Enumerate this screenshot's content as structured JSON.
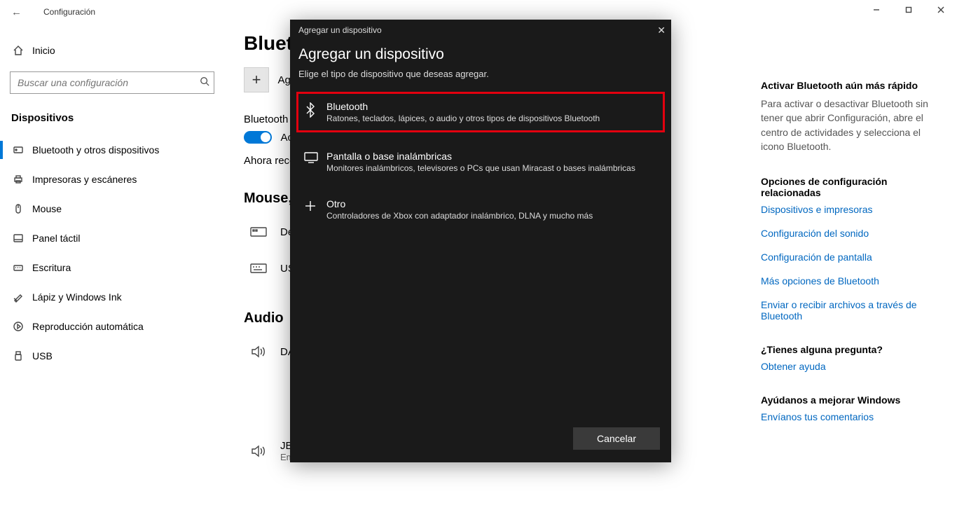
{
  "window": {
    "title": "Configuración",
    "back_icon": "back-arrow"
  },
  "sidebar": {
    "home_label": "Inicio",
    "search_placeholder": "Buscar una configuración",
    "heading": "Dispositivos",
    "items": [
      {
        "label": "Bluetooth y otros dispositivos",
        "icon": "bluetooth-icon",
        "active": true
      },
      {
        "label": "Impresoras y escáneres",
        "icon": "printer-icon"
      },
      {
        "label": "Mouse",
        "icon": "mouse-icon"
      },
      {
        "label": "Panel táctil",
        "icon": "touchpad-icon"
      },
      {
        "label": "Escritura",
        "icon": "keyboard-icon"
      },
      {
        "label": "Lápiz y Windows Ink",
        "icon": "pen-icon"
      },
      {
        "label": "Reproducción automática",
        "icon": "autoplay-icon"
      },
      {
        "label": "USB",
        "icon": "usb-icon"
      }
    ]
  },
  "main": {
    "page_title": "Bluetooth y otros dispositivos",
    "add_label": "Agregar Bluetooth u otro dispositivo",
    "bt_heading": "Bluetooth",
    "toggle_label": "Activado",
    "discover_text": "Ahora reconocible como",
    "mouse_heading": "Mouse, teclado y lápiz",
    "dev_dell": "De",
    "dev_usb": "US",
    "audio_heading": "Audio",
    "dev_da": "DA",
    "jbl_name": "JBL Xtreme",
    "jbl_status": "Emparejado"
  },
  "rpanel": {
    "tip_h": "Activar Bluetooth aún más rápido",
    "tip_txt": "Para activar o desactivar Bluetooth sin tener que abrir Configuración, abre el centro de actividades y selecciona el icono Bluetooth.",
    "related_h": "Opciones de configuración relacionadas",
    "links": [
      "Dispositivos e impresoras",
      "Configuración del sonido",
      "Configuración de pantalla",
      "Más opciones de Bluetooth",
      "Enviar o recibir archivos a través de Bluetooth"
    ],
    "q_h": "¿Tienes alguna pregunta?",
    "q_link": "Obtener ayuda",
    "improve_h": "Ayúdanos a mejorar Windows",
    "improve_link": "Envíanos tus comentarios"
  },
  "modal": {
    "title_small": "Agregar un dispositivo",
    "title": "Agregar un dispositivo",
    "hint": "Elige el tipo de dispositivo que deseas agregar.",
    "options": [
      {
        "title": "Bluetooth",
        "desc": "Ratones, teclados, lápices, o audio y otros tipos de dispositivos Bluetooth",
        "icon": "bluetooth-icon",
        "highlight": true
      },
      {
        "title": "Pantalla o base inalámbricas",
        "desc": "Monitores inalámbricos, televisores o PCs que usan Miracast o bases inalámbricas",
        "icon": "monitor-icon"
      },
      {
        "title": "Otro",
        "desc": "Controladores de Xbox con adaptador inalámbrico, DLNA y mucho más",
        "icon": "plus-icon"
      }
    ],
    "cancel": "Cancelar"
  }
}
